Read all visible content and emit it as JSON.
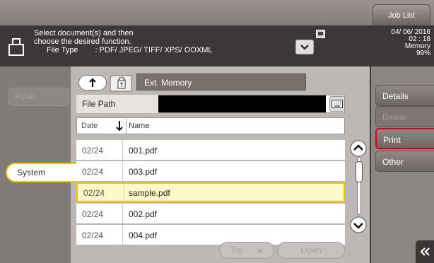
{
  "header": {
    "job_list": "Job List"
  },
  "message": {
    "line1": "Select document(s) and then",
    "line2": "choose the desired function.",
    "file_type_label": "File Type",
    "file_type_value": ": PDF/ JPEG/ TIFF/ XPS/ OOXML"
  },
  "status": {
    "date": "04/ 06/ 2016",
    "time": "02 : 18",
    "memory_label": "Memory",
    "memory_value": "99%"
  },
  "left_panel": {
    "item_disabled": "Public",
    "system_tab": "System"
  },
  "location": {
    "ext_memory": "Ext. Memory",
    "file_path_label": "File Path",
    "file_path_value": ""
  },
  "list_header": {
    "date": "Date",
    "name": "Name"
  },
  "files": [
    {
      "date": "02/24",
      "name": "001.pdf",
      "selected": false
    },
    {
      "date": "02/24",
      "name": "003.pdf",
      "selected": false
    },
    {
      "date": "02/24",
      "name": "sample.pdf",
      "selected": true
    },
    {
      "date": "02/24",
      "name": "002.pdf",
      "selected": false
    },
    {
      "date": "02/24",
      "name": "004.pdf",
      "selected": false
    }
  ],
  "bottom_buttons": {
    "top": "Top",
    "open": "Open"
  },
  "right_panel": {
    "details": "Details",
    "delete": "Delete",
    "print": "Print",
    "other": "Other"
  },
  "colors": {
    "accent_yellow": "#f0c800",
    "print_highlight": "#d8001a",
    "message_bar": "#3d3837"
  },
  "icons": {
    "folder": "folder-icon",
    "dropdown": "chevron-down-icon",
    "cart": "cart-icon",
    "up": "arrow-up-icon",
    "ext_memory": "usb-memory-icon",
    "keyboard": "keyboard-icon",
    "sort": "sort-down-icon",
    "scroll_up": "chevron-up-icon",
    "scroll_down": "chevron-down-icon",
    "back": "double-chevron-left-icon"
  }
}
